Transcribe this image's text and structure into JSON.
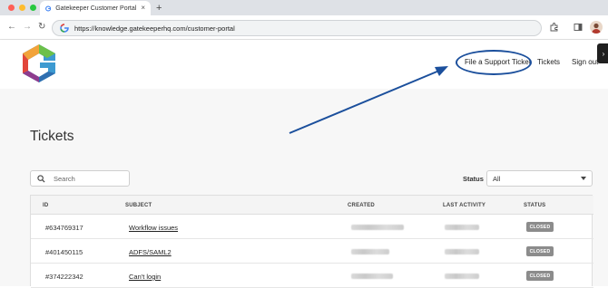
{
  "browser": {
    "tab_title": "Gatekeeper Customer Portal",
    "tab_close": "×",
    "new_tab": "+",
    "url": "https://knowledge.gatekeeperhq.com/customer-portal",
    "back": "←",
    "forward": "→",
    "reload": "↻"
  },
  "header": {
    "nav": {
      "file_ticket": "File a Support Ticket",
      "tickets": "Tickets",
      "sign_out": "Sign out"
    },
    "side_tab_glyph": "›"
  },
  "page": {
    "title": "Tickets",
    "search_placeholder": "Search",
    "status_label": "Status",
    "status_value": "All"
  },
  "table": {
    "columns": [
      "ID",
      "SUBJECT",
      "CREATED",
      "LAST ACTIVITY",
      "STATUS"
    ],
    "rows": [
      {
        "id": "#634769317",
        "subject": "Workflow issues",
        "status": "CLOSED"
      },
      {
        "id": "#401450115",
        "subject": "ADFS/SAML2",
        "status": "CLOSED"
      },
      {
        "id": "#374222342",
        "subject": "Can't login",
        "status": "CLOSED"
      }
    ]
  },
  "colors": {
    "annotation": "#1b4f9c",
    "badge": "#8c8c8c"
  }
}
